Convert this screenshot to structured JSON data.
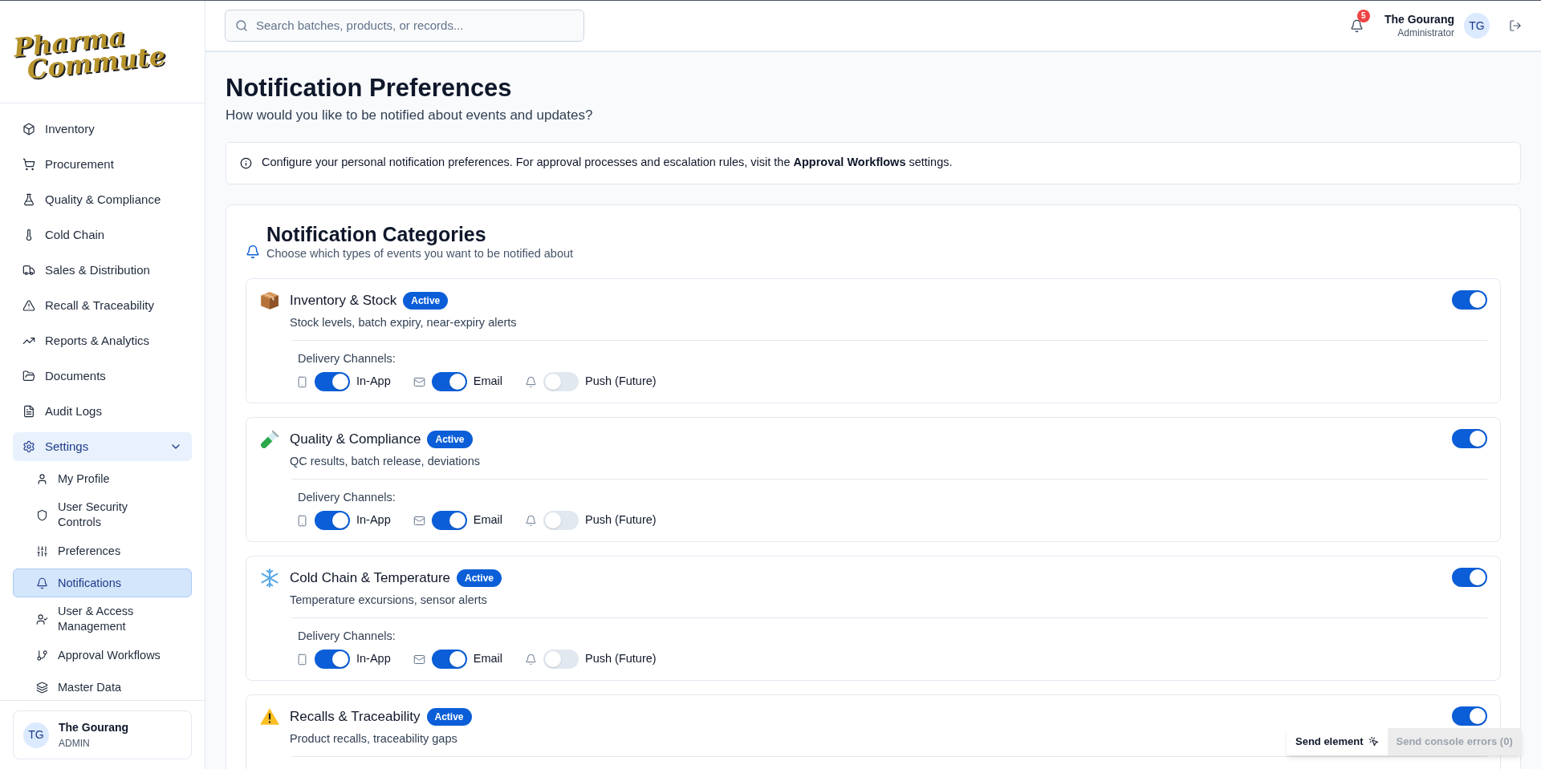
{
  "logo": {
    "lines": [
      "Pharma",
      "Commute"
    ]
  },
  "sidebar": {
    "items": [
      {
        "label": "Inventory",
        "selected": false
      },
      {
        "label": "Procurement",
        "selected": false
      },
      {
        "label": "Quality & Compliance",
        "selected": false
      },
      {
        "label": "Cold Chain",
        "selected": false
      },
      {
        "label": "Sales & Distribution",
        "selected": false
      },
      {
        "label": "Recall & Traceability",
        "selected": false
      },
      {
        "label": "Reports & Analytics",
        "selected": false
      },
      {
        "label": "Documents",
        "selected": false
      },
      {
        "label": "Audit Logs",
        "selected": false
      },
      {
        "label": "Settings",
        "selected": true,
        "expanded": true,
        "children": [
          {
            "label": "My Profile",
            "selected": false
          },
          {
            "label": "User Security Controls",
            "selected": false
          },
          {
            "label": "Preferences",
            "selected": false
          },
          {
            "label": "Notifications",
            "selected": true
          },
          {
            "label": "User & Access Management",
            "selected": false
          },
          {
            "label": "Approval Workflows",
            "selected": false
          },
          {
            "label": "Master Data",
            "selected": false
          }
        ]
      }
    ],
    "user": {
      "initials": "TG",
      "name": "The Gourang",
      "role": "ADMIN"
    }
  },
  "header": {
    "search": {
      "placeholder": "Search batches, products, or records..."
    },
    "notification_count": "5",
    "user": {
      "name": "The Gourang",
      "role": "Administrator",
      "initials": "TG"
    }
  },
  "page": {
    "title": "Notification Preferences",
    "subtitle": "How would you like to be notified about events and updates?",
    "info": "Configure your personal notification preferences. For approval processes and escalation rules, visit the **Approval Workflows** settings.",
    "section": {
      "title": "Notification Categories",
      "subtitle": "Choose which types of events you want to be notified about",
      "categories": [
        {
          "title": "Inventory & Stock",
          "badge": "Active",
          "description": "Stock levels, batch expiry, near-expiry alerts",
          "on": true,
          "channels_label": "Delivery Channels:",
          "channels": [
            {
              "label": "In-App",
              "on": true
            },
            {
              "label": "Email",
              "on": true
            },
            {
              "label": "Push (Future)",
              "on": false
            }
          ]
        },
        {
          "title": "Quality & Compliance",
          "badge": "Active",
          "description": "QC results, batch release, deviations",
          "on": true,
          "channels_label": "Delivery Channels:",
          "channels": [
            {
              "label": "In-App",
              "on": true
            },
            {
              "label": "Email",
              "on": true
            },
            {
              "label": "Push (Future)",
              "on": false
            }
          ]
        },
        {
          "title": "Cold Chain & Temperature",
          "badge": "Active",
          "description": "Temperature excursions, sensor alerts",
          "on": true,
          "channels_label": "Delivery Channels:",
          "channels": [
            {
              "label": "In-App",
              "on": true
            },
            {
              "label": "Email",
              "on": true
            },
            {
              "label": "Push (Future)",
              "on": false
            }
          ]
        },
        {
          "title": "Recalls & Traceability",
          "badge": "Active",
          "description": "Product recalls, traceability gaps",
          "on": true
        }
      ]
    }
  },
  "devtools": {
    "send_element": "Send element",
    "send_errors": "Send console errors (0)"
  }
}
